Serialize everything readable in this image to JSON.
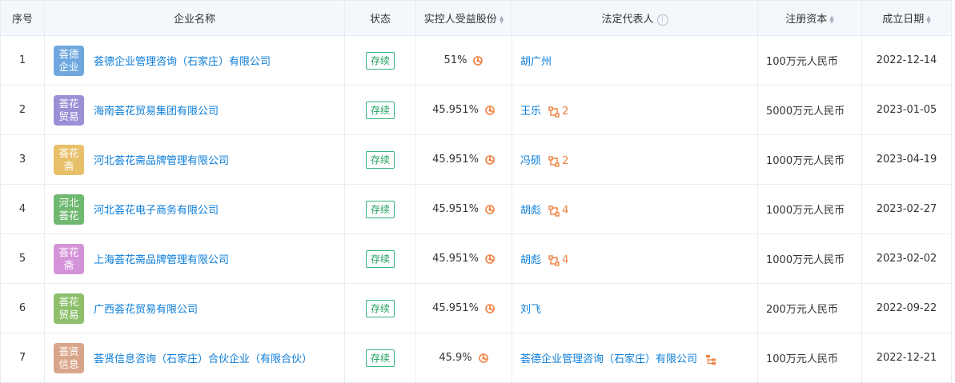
{
  "headers": {
    "index": "序号",
    "company": "企业名称",
    "status": "状态",
    "shares": "实控人受益股份",
    "legal": "法定代表人",
    "capital": "注册资本",
    "date": "成立日期"
  },
  "rows": [
    {
      "index": "1",
      "logo_line1": "荟德",
      "logo_line2": "企业",
      "logo_color": "#6ea8de",
      "company": "荟德企业管理咨询（石家庄）有限公司",
      "status": "存续",
      "share": "51%",
      "legal": "胡广州",
      "rel_count": "",
      "capital": "100万元人民币",
      "date": "2022-12-14"
    },
    {
      "index": "2",
      "logo_line1": "荟花",
      "logo_line2": "贸易",
      "logo_color": "#9b8fd6",
      "company": "海南荟花贸易集团有限公司",
      "status": "存续",
      "share": "45.951%",
      "legal": "王乐",
      "rel_count": "2",
      "capital": "5000万元人民币",
      "date": "2023-01-05"
    },
    {
      "index": "3",
      "logo_line1": "荟花",
      "logo_line2": "斋",
      "logo_color": "#e8c06a",
      "company": "河北荟花斋品牌管理有限公司",
      "status": "存续",
      "share": "45.951%",
      "legal": "冯硕",
      "rel_count": "2",
      "capital": "1000万元人民币",
      "date": "2023-04-19"
    },
    {
      "index": "4",
      "logo_line1": "河北",
      "logo_line2": "荟花",
      "logo_color": "#6fb870",
      "company": "河北荟花电子商务有限公司",
      "status": "存续",
      "share": "45.951%",
      "legal": "胡彪",
      "rel_count": "4",
      "capital": "1000万元人民币",
      "date": "2023-02-27"
    },
    {
      "index": "5",
      "logo_line1": "荟花",
      "logo_line2": "斋",
      "logo_color": "#d492d8",
      "company": "上海荟花斋品牌管理有限公司",
      "status": "存续",
      "share": "45.951%",
      "legal": "胡彪",
      "rel_count": "4",
      "capital": "1000万元人民币",
      "date": "2023-02-02"
    },
    {
      "index": "6",
      "logo_line1": "荟花",
      "logo_line2": "贸易",
      "logo_color": "#8ec06c",
      "company": "广西荟花贸易有限公司",
      "status": "存续",
      "share": "45.951%",
      "legal": "刘飞",
      "rel_count": "",
      "capital": "200万元人民币",
      "date": "2022-09-22"
    },
    {
      "index": "7",
      "logo_line1": "荟贤",
      "logo_line2": "信息",
      "logo_color": "#d9a58a",
      "company": "荟贤信息咨询（石家庄）合伙企业（有限合伙）",
      "status": "存续",
      "share": "45.9%",
      "legal": "荟德企业管理咨询（石家庄）有限公司",
      "rel_count": "",
      "capital": "100万元人民币",
      "date": "2022-12-21"
    }
  ],
  "icons": {
    "share_icon": "equity-chart-icon",
    "relation_icon": "relation-graph-icon",
    "corp_icon": "corporate-structure-icon",
    "info_icon": "info-icon"
  },
  "colors": {
    "link": "#0b7dd9",
    "status_green": "#36b37e",
    "orange": "#f08040",
    "header_bg": "#f4f8fc"
  }
}
